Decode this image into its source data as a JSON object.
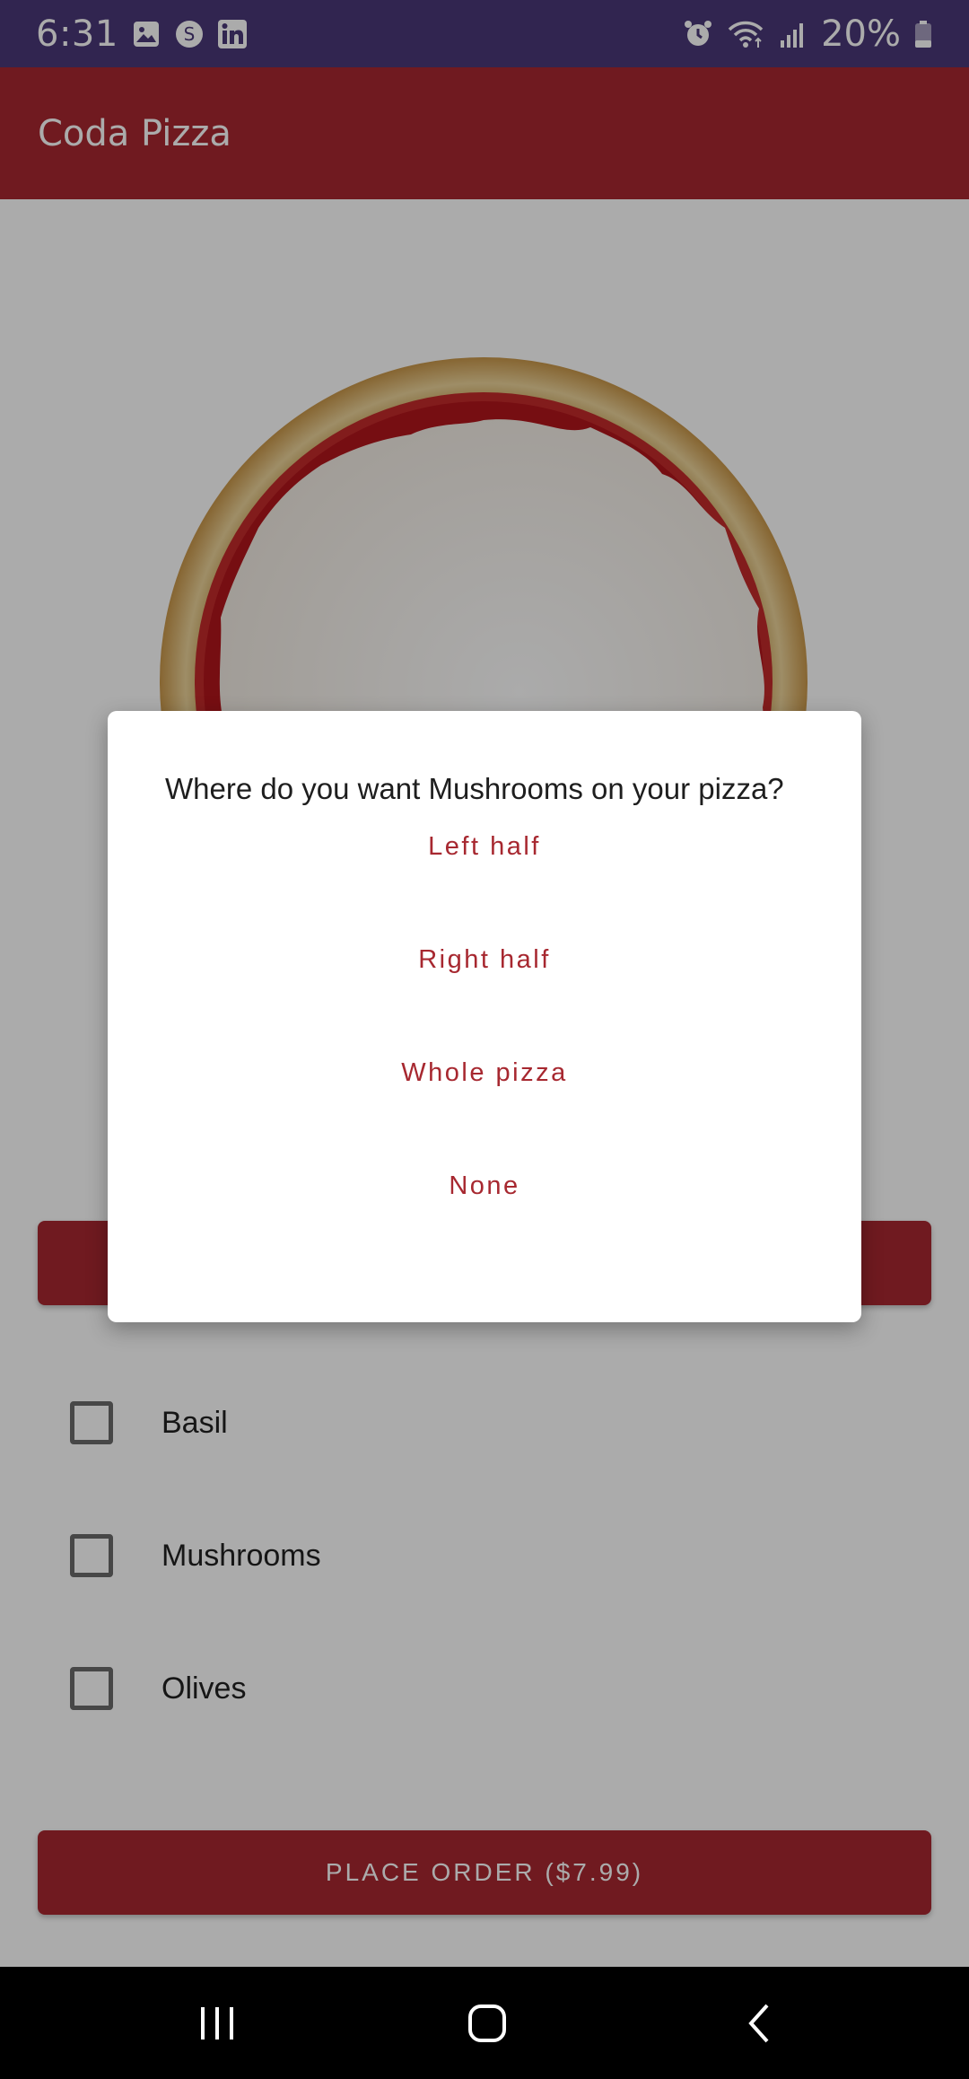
{
  "status_bar": {
    "time": "6:31",
    "battery_percent": "20%",
    "icons_left": [
      "image-icon",
      "s-app-icon",
      "linkedin-icon"
    ],
    "icons_right": [
      "alarm-icon",
      "wifi-icon",
      "signal-icon",
      "battery-icon"
    ]
  },
  "app_bar": {
    "title": "Coda Pizza"
  },
  "toppings": [
    {
      "label": "Basil",
      "checked": false
    },
    {
      "label": "Mushrooms",
      "checked": false
    },
    {
      "label": "Olives",
      "checked": false
    }
  ],
  "order_button": {
    "label": "PLACE ORDER ($7.99)"
  },
  "dialog": {
    "title": "Where do you want Mushrooms on your pizza?",
    "options": [
      "Left half",
      "Right half",
      "Whole pizza",
      "None"
    ]
  },
  "colors": {
    "primary": "#a72830",
    "status_bar": "#4a3878",
    "scrim": "rgba(0,0,0,0.33)"
  }
}
